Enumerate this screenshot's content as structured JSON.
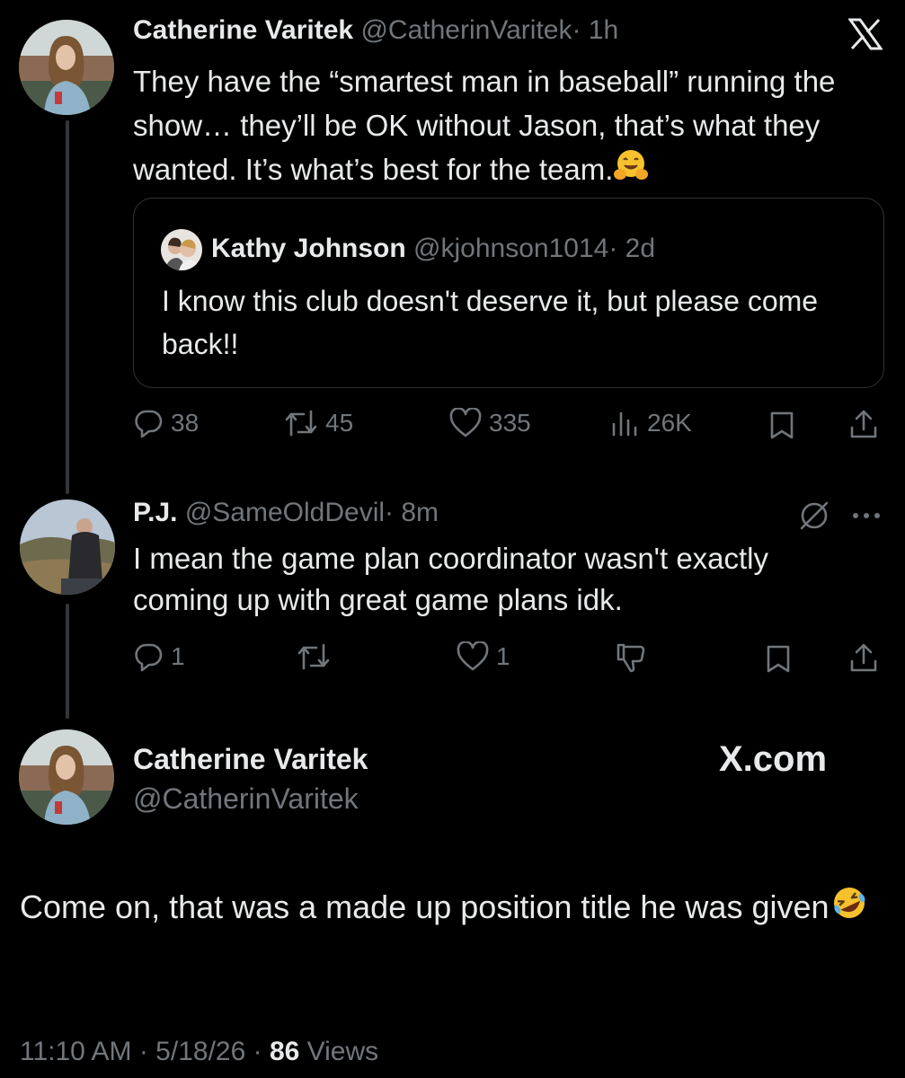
{
  "tweet1": {
    "author_name": "Catherine Varitek",
    "handle": "@CatherinVaritek",
    "time": "· 1h",
    "text": "They have the “smartest man in baseball” running the show… they’ll be OK without Jason, that’s what they wanted. It’s what’s best for the team.",
    "emoji_icon": "hugging-face-emoji",
    "quote": {
      "author_name": "Kathy Johnson",
      "handle": "@kjohnson1014",
      "time": "· 2d",
      "text": "I know this club doesn't deserve it, but please come back!!"
    },
    "stats": {
      "replies": "38",
      "reposts": "45",
      "likes": "335",
      "views": "26K"
    }
  },
  "tweet2": {
    "author_name": "P.J.",
    "handle": "@SameOldDevil",
    "time": "· 8m",
    "text": "I mean the game plan coordinator wasn't exactly coming up with great game plans idk.",
    "stats": {
      "replies": "1",
      "likes": "1"
    }
  },
  "main_post": {
    "author_name": "Catherine Varitek",
    "handle": "@CatherinVaritek",
    "brand": "X.com",
    "text": "Come on, that was a made up position title he was given",
    "emoji_icon": "rolling-laughing-emoji",
    "timestamp": "11:10 AM · 5/18/26 · ",
    "views_count": "86",
    "views_label": " Views"
  },
  "colors": {
    "background": "#000000",
    "text": "#e7e9ea",
    "muted": "#71767b",
    "border": "#2f3336"
  }
}
